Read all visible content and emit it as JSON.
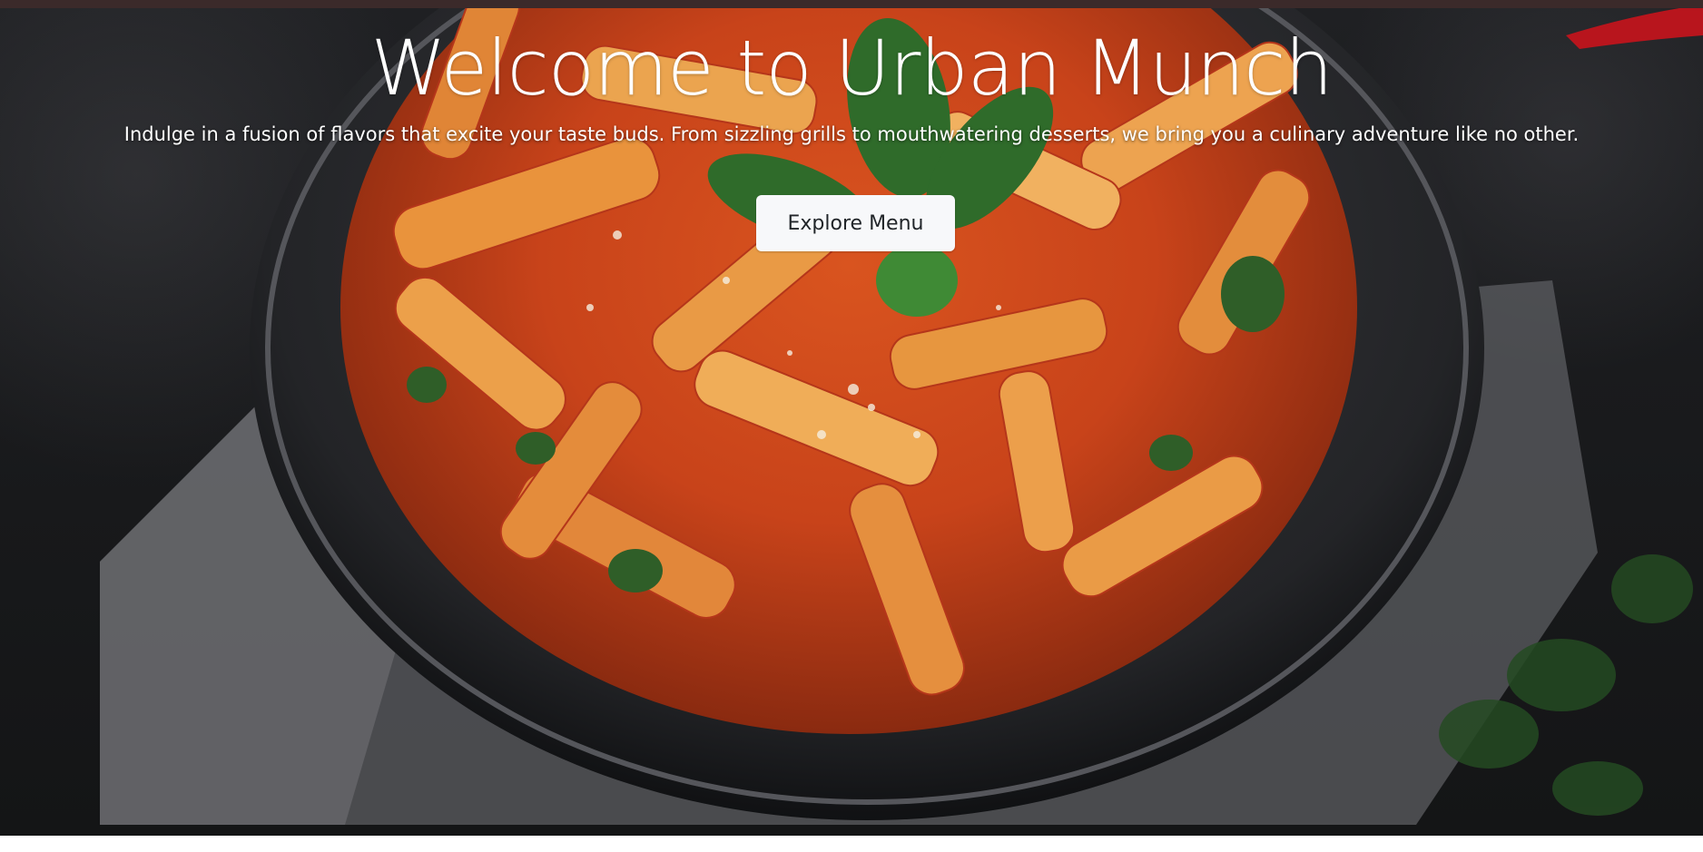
{
  "hero": {
    "title": "Welcome to Urban Munch",
    "subtitle": "Indulge in a fusion of flavors that excite your taste buds. From sizzling grills to mouthwatering desserts, we bring you a culinary adventure like no other.",
    "cta_label": "Explore Menu",
    "background_image": "pasta-bowl-image"
  },
  "colors": {
    "title_text": "#ffffff",
    "button_bg": "#f7f8fa",
    "button_text": "#212529",
    "backdrop": "#1a1b1d"
  }
}
